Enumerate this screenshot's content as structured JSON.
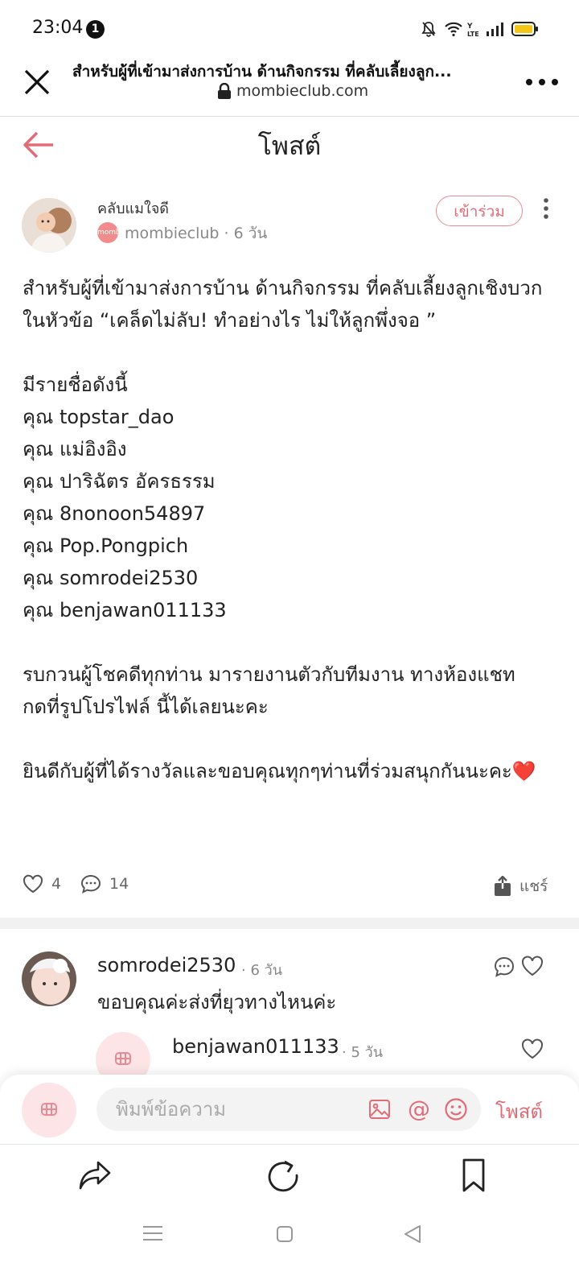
{
  "status_bar": {
    "time": "23:04",
    "notification_count": "1"
  },
  "browser": {
    "page_title": "สำหรับผู้ที่เข้ามาส่งการบ้าน ด้านกิจกรรม ที่คลับเลี้ยงลูก...",
    "url": "mombieclub.com"
  },
  "header": {
    "title": "โพสต์"
  },
  "post": {
    "club_name": "คลับแมใจดี",
    "logo_text": "mombie",
    "author": "mombieclub",
    "time": "· 6 วัน",
    "join_label": "เข้าร่วม",
    "body": [
      "สำหรับผู้ที่เข้ามาส่งการบ้าน ด้านกิจกรรม ที่คลับเลี้ยงลูกเชิงบวก",
      "ในหัวข้อ “เคล็ดไม่ลับ! ทำอย่างไร ไม่ให้ลูกพึ่งจอ ”",
      "",
      "มีรายชื่อดังนี้",
      "คุณ topstar_dao",
      "คุณ แม่อิงอิง",
      "คุณ ปาริฉัตร อัครธรรม",
      "คุณ 8nonoon54897",
      "คุณ Pop.Pongpich",
      "คุณ somrodei2530",
      "คุณ benjawan011133",
      "",
      "รบกวนผู้โชคดีทุกท่าน มารายงานตัวกับทีมงาน ทางห้องแชท",
      "กดที่รูปโปรไฟล์ นี้ได้เลยนะคะ",
      "",
      "ยินดีกับผู้ที่ได้รางวัลและขอบคุณทุกๆท่านที่ร่วมสนุกกันนะคะ❤️"
    ],
    "like_count": "4",
    "comment_count": "14",
    "share_label": "แชร์"
  },
  "comments": [
    {
      "user": "somrodei2530",
      "time": "· 6 วัน",
      "text": "ขอบคุณค่ะส่งที่ยุวทางไหนค่ะ"
    },
    {
      "user": "benjawan011133",
      "time": "· 5 วัน"
    }
  ],
  "composer": {
    "placeholder": "พิมพ์ข้อความ",
    "mention_symbol": "@",
    "post_label": "โพสต์"
  },
  "colors": {
    "accent": "#e26b76",
    "muted": "#888888"
  }
}
